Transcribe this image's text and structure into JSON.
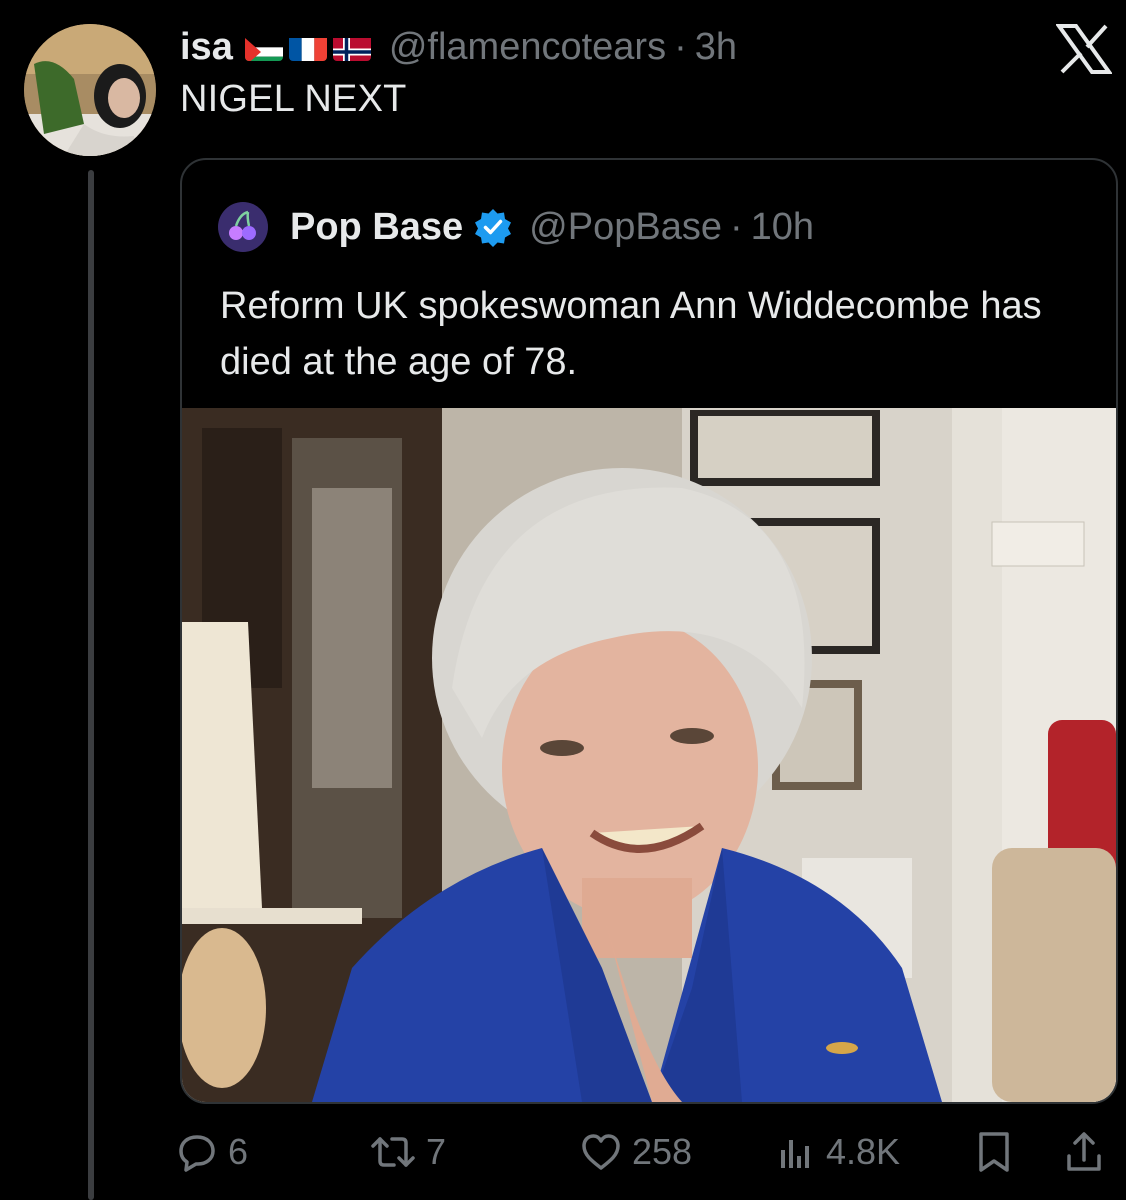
{
  "post": {
    "author_name": "isa",
    "handle": "@flamencotears",
    "separator": "·",
    "time": "3h",
    "text": "NIGEL NEXT",
    "flags": [
      "palestine-flag",
      "france-flag",
      "norway-flag"
    ]
  },
  "quoted_post": {
    "author_name": "Pop Base",
    "handle": "@PopBase",
    "separator": "·",
    "time": "10h",
    "text": "Reform UK spokeswoman Ann Widdecombe has died at the age of 78."
  },
  "actions": {
    "replies": "6",
    "reposts": "7",
    "likes": "258",
    "views": "4.8K"
  },
  "colors": {
    "background": "#000000",
    "text_primary": "#e7e9ea",
    "text_secondary": "#71767b",
    "verified": "#1d9bf0",
    "border": "#2f3336"
  }
}
